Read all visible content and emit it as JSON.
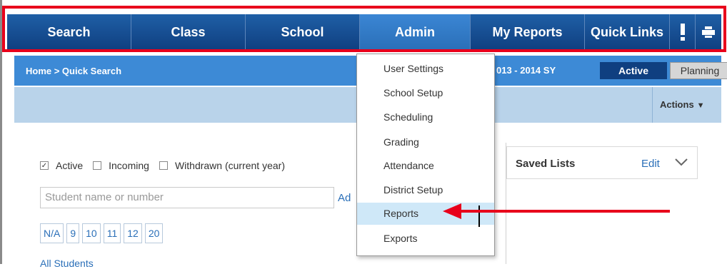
{
  "nav": {
    "items": [
      {
        "label": "Search"
      },
      {
        "label": "Class"
      },
      {
        "label": "School"
      },
      {
        "label": "Admin"
      },
      {
        "label": "My Reports"
      },
      {
        "label": "Quick Links"
      }
    ]
  },
  "breadcrumb": "Home > Quick Search",
  "school_year": "013 - 2014 SY",
  "mode": {
    "active": "Active",
    "planning": "Planning"
  },
  "actions_label": "Actions",
  "filters": [
    {
      "label": "Active",
      "checked": true
    },
    {
      "label": "Incoming",
      "checked": false
    },
    {
      "label": "Withdrawn (current year)",
      "checked": false
    }
  ],
  "search": {
    "placeholder": "Student name or number",
    "advanced_link": "Ad"
  },
  "grades": [
    "N/A",
    "9",
    "10",
    "11",
    "12",
    "20"
  ],
  "all_students": "All Students",
  "saved_lists": {
    "title": "Saved Lists",
    "edit": "Edit"
  },
  "admin_menu": {
    "items": [
      {
        "label": "User Settings"
      },
      {
        "label": "School Setup"
      },
      {
        "label": "Scheduling"
      },
      {
        "label": "Grading"
      },
      {
        "label": "Attendance"
      },
      {
        "label": "District Setup"
      },
      {
        "label": "Reports",
        "highlighted": true
      },
      {
        "label": "Exports"
      }
    ]
  },
  "colors": {
    "nav": "#0f3f80",
    "nav_active": "#3b86d4",
    "crumbbar": "#3d8ad6",
    "annotation": "#e8001b",
    "menu_highlight": "#cfe8f8"
  }
}
